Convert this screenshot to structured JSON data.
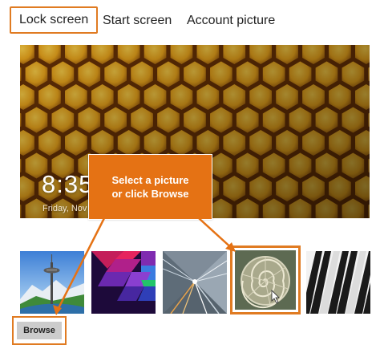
{
  "tabs": [
    {
      "label": "Lock screen",
      "active": true
    },
    {
      "label": "Start screen",
      "active": false
    },
    {
      "label": "Account picture",
      "active": false
    }
  ],
  "lock_preview": {
    "time": "8:35",
    "date": "Friday, Nov"
  },
  "callout": {
    "line1": "Select a picture",
    "line2": "or click Browse"
  },
  "thumbnails": [
    {
      "name": "space-needle"
    },
    {
      "name": "colorful-squares"
    },
    {
      "name": "tunnel-lights"
    },
    {
      "name": "nautilus-shell",
      "selected": true
    },
    {
      "name": "piano-keys"
    }
  ],
  "browse": {
    "label": "Browse"
  },
  "colors": {
    "highlight": "#e07b22",
    "callout": "#e57214"
  }
}
